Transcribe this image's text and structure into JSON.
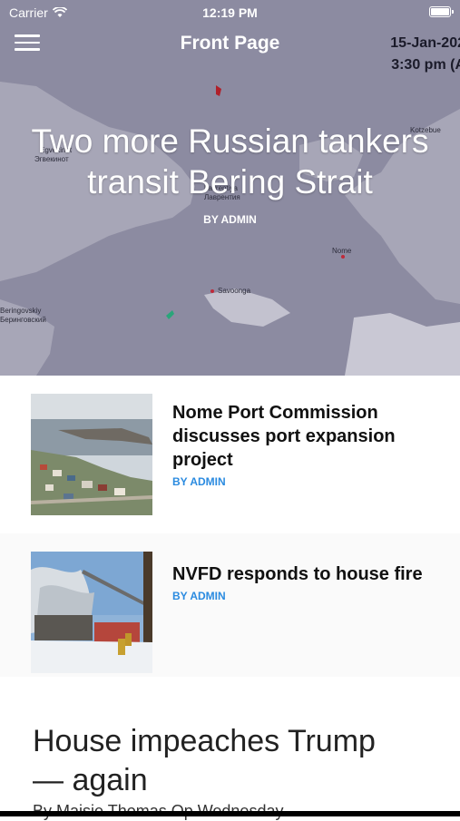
{
  "status_bar": {
    "carrier": "Carrier",
    "time": "12:19 PM"
  },
  "nav": {
    "title": "Front Page",
    "menu_icon": "hamburger-menu-icon"
  },
  "hero": {
    "map_date": "15-Jan-202",
    "map_time": "3:30 pm (A",
    "headline": "Two more Russian tankers transit Bering Strait",
    "byline": "BY ADMIN",
    "map_labels": [
      "Kotzebue",
      "Egvekinot",
      "Эгвекинот",
      "Lavrentiya",
      "Лаврентия",
      "Nome",
      "Savoonga",
      "Beringovskiy",
      "Беринговский"
    ]
  },
  "articles": [
    {
      "title": "Nome Port Commission discusses port expansion project",
      "byline": "BY ADMIN"
    },
    {
      "title": "NVFD responds to house fire",
      "byline": "BY ADMIN"
    }
  ],
  "feature": {
    "headline": "House impeaches Trump — again",
    "byline": "By Maisie Thomas Op Wednesday"
  },
  "colors": {
    "accent": "#2b8be0",
    "map_water": "#8c8ba1",
    "map_land": "#d9d9e0"
  }
}
